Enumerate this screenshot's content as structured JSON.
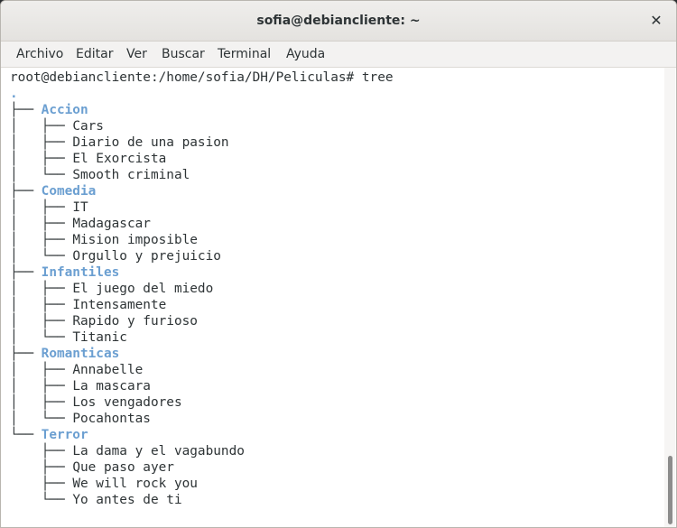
{
  "window": {
    "title": "sofia@debiancliente: ~",
    "close_glyph": "✕"
  },
  "menu": [
    "Archivo",
    "Editar",
    "Ver",
    "Buscar",
    "Terminal",
    "Ayuda"
  ],
  "terminal": {
    "prompt": "root@debiancliente:/home/sofia/DH/Peliculas# ",
    "command": "tree",
    "root": ".",
    "branch_mid": "├── ",
    "branch_last": "└── ",
    "pipe": "│   ",
    "space": "    ",
    "dir_color": "#6b9fd1",
    "tree": [
      {
        "name": "Accion",
        "files": [
          "Cars",
          "Diario de una pasion",
          "El Exorcista",
          "Smooth criminal"
        ]
      },
      {
        "name": "Comedia",
        "files": [
          "IT",
          "Madagascar",
          "Mision imposible",
          "Orgullo y prejuicio"
        ]
      },
      {
        "name": "Infantiles",
        "files": [
          "El juego del miedo",
          "Intensamente",
          "Rapido y furioso",
          "Titanic"
        ]
      },
      {
        "name": "Romanticas",
        "files": [
          "Annabelle",
          "La mascara",
          "Los vengadores",
          "Pocahontas"
        ]
      },
      {
        "name": "Terror",
        "files": [
          "La dama y el vagabundo",
          "Que paso ayer",
          "We will rock you",
          "Yo antes de ti"
        ]
      }
    ]
  }
}
